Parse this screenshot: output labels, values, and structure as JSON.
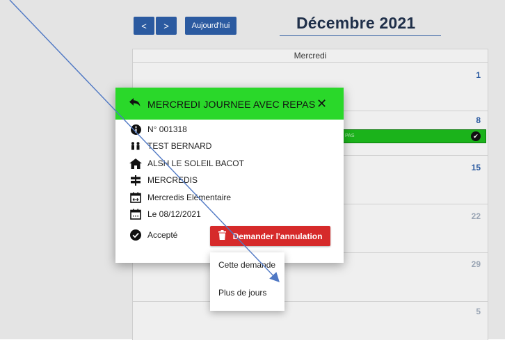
{
  "toolbar": {
    "prev_icon": "chevron-left-icon",
    "prev_glyph": "<",
    "next_icon": "chevron-right-icon",
    "next_glyph": ">",
    "today_label": "Aujourd'hui",
    "month_title": "Décembre 2021"
  },
  "calendar": {
    "column_header": "Mercredi",
    "days": [
      "1",
      "8",
      "15",
      "22",
      "29",
      "5"
    ],
    "event": {
      "text": "PAS",
      "color": "#1bb31b",
      "status_icon": "check-circle-icon"
    }
  },
  "modal": {
    "title": "MERCREDI JOURNEE AVEC REPAS",
    "header_color": "#2ad82a",
    "number": "N° 001318",
    "person": "TEST BERNARD",
    "center": "ALSH LE SOLEIL BACOT",
    "activity": "MERCREDIS",
    "group": "Mercredis Elémentaire",
    "date": "Le 08/12/2021",
    "status": "Accepté",
    "cancel_button": "Demander l'annulation",
    "cancel_color": "#d62a2a"
  },
  "cancel_menu": {
    "items": [
      "Cette demande",
      "Plus de jours"
    ]
  }
}
